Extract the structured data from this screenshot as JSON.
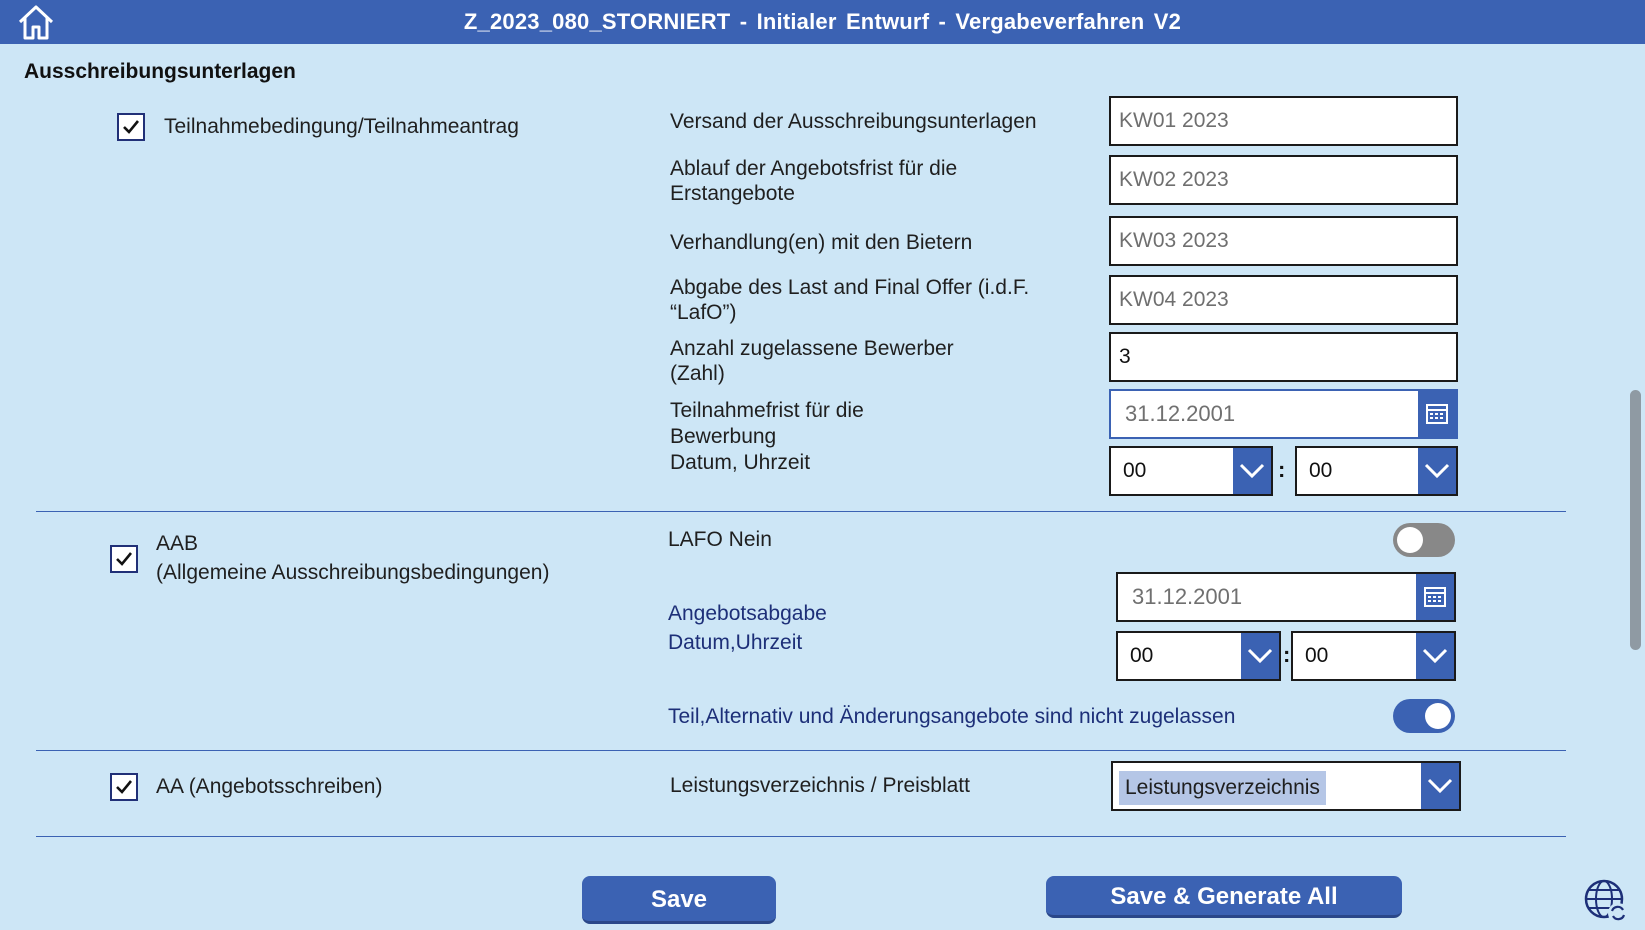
{
  "header": {
    "title": "Z_2023_080_STORNIERT  -  Initialer Entwurf  -  Vergabeverfahren V2",
    "home_icon": "home-icon"
  },
  "section": {
    "title": "Ausschreibungsunterlagen"
  },
  "block1": {
    "checkbox_label": "Teilnahmebedingung/Teilnahmeantrag",
    "checked": true,
    "rows": [
      {
        "label": "Versand der Ausschreibungsunterlagen",
        "value": "KW01 2023"
      },
      {
        "label": "Ablauf der Angebotsfrist für die Erstangebote",
        "value": "KW02 2023"
      },
      {
        "label": "Verhandlung(en) mit den Bietern",
        "value": "KW03 2023"
      },
      {
        "label": "Abgabe des Last and Final Offer (i.d.F. “LafO”)",
        "value": "KW04 2023"
      },
      {
        "label": "Anzahl zugelassene Bewerber (Zahl)",
        "value": "3"
      }
    ],
    "deadline_label_1": "Teilnahmefrist für die",
    "deadline_label_2": "Bewerbung",
    "deadline_label_3": "Datum, Uhrzeit",
    "deadline_date": "31.12.2001",
    "deadline_hour": "00",
    "deadline_minute": "00"
  },
  "block2": {
    "checkbox_label_1": "AAB",
    "checkbox_label_2": "(Allgemeine Ausschreibungsbedingungen)",
    "checked": true,
    "lafo_label": "LAFO Nein",
    "lafo_toggle": false,
    "offer_label_1": "Angebotsabgabe",
    "offer_label_2": "Datum,Uhrzeit",
    "offer_date": "31.12.2001",
    "offer_hour": "00",
    "offer_minute": "00",
    "alt_label": "Teil,Alternativ und Änderungsangebote sind nicht zugelassen",
    "alt_toggle": true
  },
  "block3": {
    "checkbox_label": "AA (Angebotsschreiben)",
    "checked": true,
    "select_label": "Leistungsverzeichnis / Preisblatt",
    "select_value": "Leistungsverzeichnis"
  },
  "footer": {
    "save_label": "Save",
    "save_all_label": "Save & Generate All",
    "globe_icon": "globe-refresh-icon"
  },
  "colors": {
    "accent": "#3b62b3",
    "background": "#cde6f6",
    "label_blue": "#1d2f78"
  }
}
